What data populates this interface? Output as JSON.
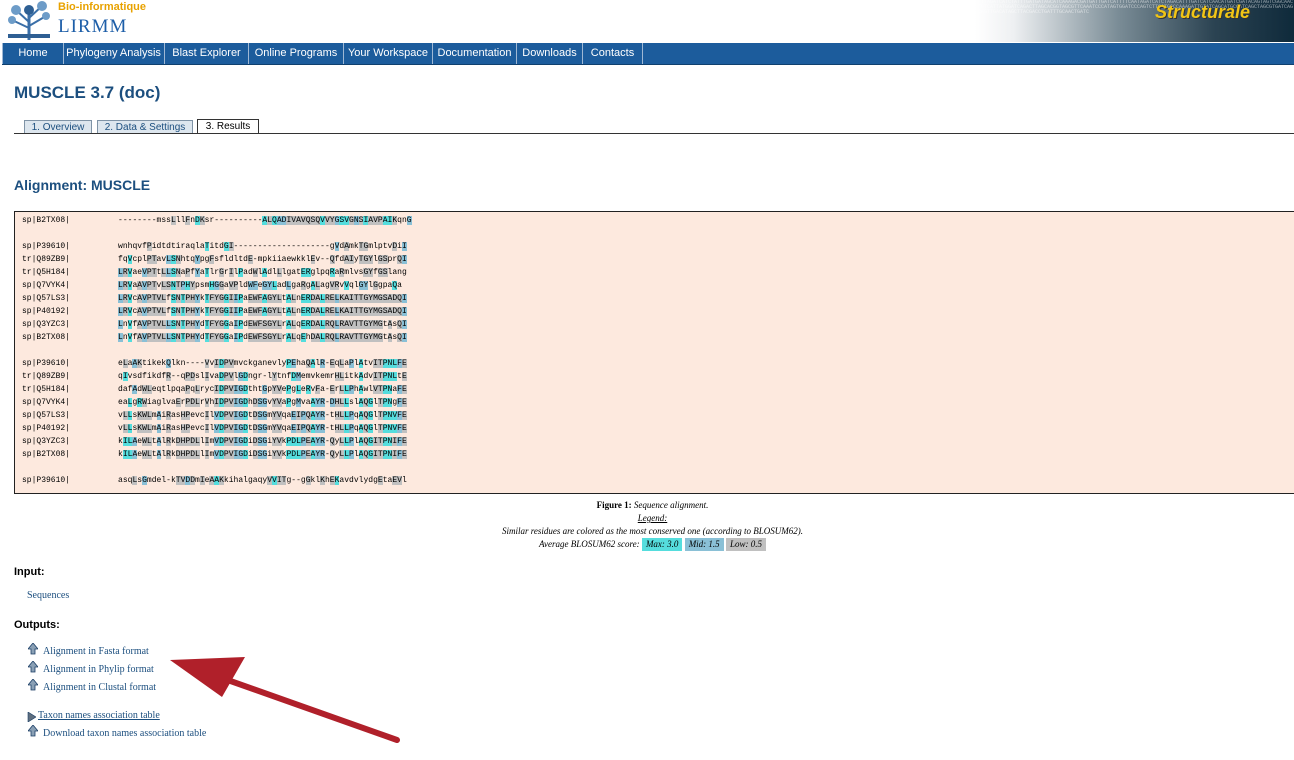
{
  "header": {
    "logo_top": "Bio-informatique",
    "logo_main": "LIRMM",
    "banner_title": "Structurale",
    "banner_sequence": "CTTTAGATCATCTATTTGATGATAGCATCAAAGACGATGATTGATCATTTTCAATAGATCATCTAGACATTTGATCATCAACATGATCGATACAGTAGTCGGCAACTTGTCATTATGGATCAGACTTAGCACGGTAGCGTTCAAATCCCATAGTGGATCCCAGTCTTGATGGCCAAAGATTGTATCAGCATGCGATCAGCTAGCGTGATCAGTCAGTTGACATAGCTTACGACCTGATTTGCAACTGATC"
  },
  "nav": {
    "items": [
      "Home",
      "Phylogeny Analysis",
      "Blast Explorer",
      "Online Programs",
      "Your Workspace",
      "Documentation",
      "Downloads",
      "Contacts"
    ]
  },
  "page": {
    "title": "MUSCLE 3.7 (doc)"
  },
  "tabs": [
    {
      "label": "1. Overview",
      "active": false
    },
    {
      "label": "2. Data & Settings",
      "active": false
    },
    {
      "label": "3. Results",
      "active": true
    }
  ],
  "alignment": {
    "title": "Alignment: MUSCLE",
    "blocks": [
      {
        "rows": [
          {
            "name": "sp|B2TX08|",
            "seq": "--------mssLllFnDKsr----------ALQADIVAVQSQVVYGSVGNSIAVPAIKqnG"
          }
        ]
      },
      {
        "rows": [
          {
            "name": "sp|P39610|",
            "seq": "wnhqvfPidtdtiraqlaTitdGI--------------------gVdAmkTGmlptvDiI"
          },
          {
            "name": "tr|Q89ZB9|",
            "seq": "fqVcplPTavLSNhtqYpgFsfldltdE-mpkiiaewkklEv--QfdAIyTGYlGSprQI"
          },
          {
            "name": "tr|Q5H184|",
            "seq": "LRVaeVPTtLLSNaPfYaTlrGrIlPadWlAdlLlgatERglpqRaRmlvsGYfGSlang"
          },
          {
            "name": "sp|Q7VYK4|",
            "seq": "LRVaAVPTvLSNTPHYpsmHGGaVPldWFeGYLadLgaRgALagVRvVqlGYlGgpaQa"
          },
          {
            "name": "sp|Q57LS3|",
            "seq": "LRVcAVPTVLfSNTPHYkTFYGGIIPaEWFAGYLtALnERDALRELKAITTGYMGSADQI"
          },
          {
            "name": "sp|P40192|",
            "seq": "LRVcAVPTVLfSNTPHYkTFYGGIIPaEWFAGYLtALnERDALRELKAITTGYMGSADQI"
          },
          {
            "name": "sp|Q3YZC3|",
            "seq": "LnVfAVPTVLLSNTPHYdTFYGGaIPdEWFSGYLrALqERDALRQLRAVTTGYMGtAsQI"
          },
          {
            "name": "sp|B2TX08|",
            "seq": "LnVfAVPTVLLSNTPHYdTFYGGaIPdEWFSGYLrALqEhDALRQLRAVTTGYMGtAsQI"
          }
        ]
      },
      {
        "rows": [
          {
            "name": "sp|P39610|",
            "seq": "eLaAKtikekQlkn----VvIDPVmvckganevlyPEhaQAlR-EqLaPlAtvITPNLFE"
          },
          {
            "name": "tr|Q89ZB9|",
            "seq": "qIvsdfikdfR--qPDslIvaDPVlGDngr-lYtnfDMemvkemrHLitkAdvITPNLtE"
          },
          {
            "name": "tr|Q5H184|",
            "seq": "dafAdWLeqtlpqaPqLrycIDPVIGDthtGpYVePgLeRvFa-ErLLPhAwlVTPNaFE"
          },
          {
            "name": "sp|Q7VYK4|",
            "seq": "eaLgRWiaglvaErPDLrVhIDPVIGDhDSGvYVaPgMvaAYR-DHLLslAQGlTPNgFE"
          },
          {
            "name": "sp|Q57LS3|",
            "seq": "vLLsKWLmAiRasHPevcIlVDPVIGDtDSGmYVqaEIPQAYR-tHLLPqAQGlTPNVFE"
          },
          {
            "name": "sp|P40192|",
            "seq": "vLLsKWLmAiRasHPevcIlVDPVIGDtDSGmYVqaEIPQAYR-tHLLPqAQGlTPNVFE"
          },
          {
            "name": "sp|Q3YZC3|",
            "seq": "kILAeWLtAlRkDHPDLlImVDPVIGDiDSGiYVkPDLPEAYR-QyLLPlAQGITPNIFE"
          },
          {
            "name": "sp|B2TX08|",
            "seq": "kILAeWLtAlRkDHPDLlImVDPVIGDiDSGiYVkPDLPEAYR-QyLLPlAQGITPNIFE"
          }
        ]
      },
      {
        "rows": [
          {
            "name": "sp|P39610|",
            "seq": "asqLsGmdel-kTVDDmIeAAKkihalgaqyVVITg--gGklKhEKavdvlydgEtaEVl"
          }
        ]
      }
    ]
  },
  "caption": {
    "figure_label": "Figure 1:",
    "figure_text": "Sequence alignment.",
    "legend_label": "Legend:",
    "similar_text": "Similar residues are colored as the most conserved one (according to BLOSUM62).",
    "score_label": "Average BLOSUM62 score:",
    "max_label": "Max: 3.0",
    "mid_label": "Mid: 1.5",
    "low_label": "Low: 0.5",
    "max_color": "#55dddd",
    "mid_color": "#8ac0d6",
    "low_color": "#c0c0c0"
  },
  "input": {
    "label": "Input:",
    "sequences_link": "Sequences"
  },
  "outputs": {
    "label": "Outputs:",
    "links": [
      "Alignment in Fasta format",
      "Alignment in Phylip format",
      "Alignment in Clustal format"
    ],
    "taxon_table_link": "Taxon names association table",
    "taxon_download_link": "Download taxon names association table"
  },
  "colors": {
    "nav_bg": "#1c5c9c",
    "title_color": "#1c4f7f",
    "alignment_bg": "#fde9de",
    "arrow_color": "#b0202a"
  }
}
